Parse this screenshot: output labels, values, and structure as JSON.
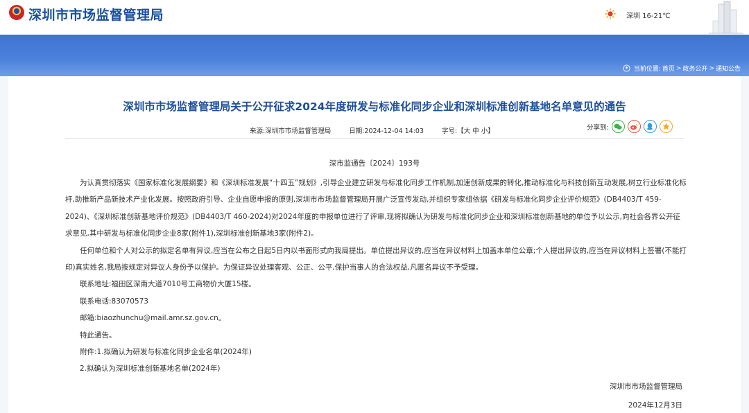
{
  "header": {
    "site_name": "深圳市市场监督管理局",
    "weather": "深圳 16-21℃"
  },
  "breadcrumb": {
    "prefix": "当前位置:",
    "items": [
      "首页",
      "政务公开",
      "通知公告"
    ],
    "separator": ">"
  },
  "article": {
    "title": "深圳市市场监督管理局关于公开征求2024年度研发与标准化同步企业和深圳标准创新基地名单意见的通告",
    "source": "来源:深圳市市场监督管理局",
    "date": "日期:2024-12-04 14:03",
    "font_size_label": "字号:【大 中 小】",
    "share_label": "分享到:",
    "share_icons": [
      "wechat-icon",
      "weibo-icon",
      "qq-icon",
      "qzone-icon"
    ],
    "doc_number": "深市监通告〔2024〕193号",
    "paragraphs": [
      "为认真贯彻落实《国家标准化发展纲要》和《深圳标准发展“十四五”规划》,引导企业建立研发与标准化同步工作机制,加速创新成果的转化,推动标准化与科技创新互动发展,树立行业标准化标杆,助推新产品新技术产业化发展。按照政府引导、企业自愿申报的原则,深圳市市场监督管理局开展广泛宣传发动,并组织专家组依据《研发与标准化同步企业评价规范》(DB4403/T 459-2024)、《深圳标准创新基地评价规范》(DB4403/T 460-2024)对2024年度的申报单位进行了评审,现将拟确认为研发与标准化同步企业和深圳标准创新基地的单位予以公示,向社会各界公开征求意见,其中研发与标准化同步企业8家(附件1),深圳标准创新基地3家(附件2)。",
      "任何单位和个人对公示的拟定名单有异议,应当在公布之日起5日内以书面形式向我局提出。单位提出异议的,应当在异议材料上加盖本单位公章;个人提出异议的,应当在异议材料上签署(不能打印)真实姓名,我局按规定对异议人身份予以保护。为保证异议处理客观、公正、公平,保护当事人的合法权益,凡匿名异议不予受理。",
      "联系地址:福田区深南大道7010号工商物价大厦15楼。",
      "联系电话:83070573",
      "邮箱:biaozhunchu@mail.amr.sz.gov.cn。",
      "特此通告。",
      "附件:1.拟确认为研发与标准化同步企业名单(2024年)",
      "2.拟确认为深圳标准创新基地名单(2024年)"
    ],
    "signature_org": "深圳市市场监督管理局",
    "signature_date": "2024年12月3日"
  },
  "colors": {
    "brand_blue": "#1a4f9e",
    "banner_blue": "#4a7fd9",
    "title_blue": "#1d4f9c"
  }
}
